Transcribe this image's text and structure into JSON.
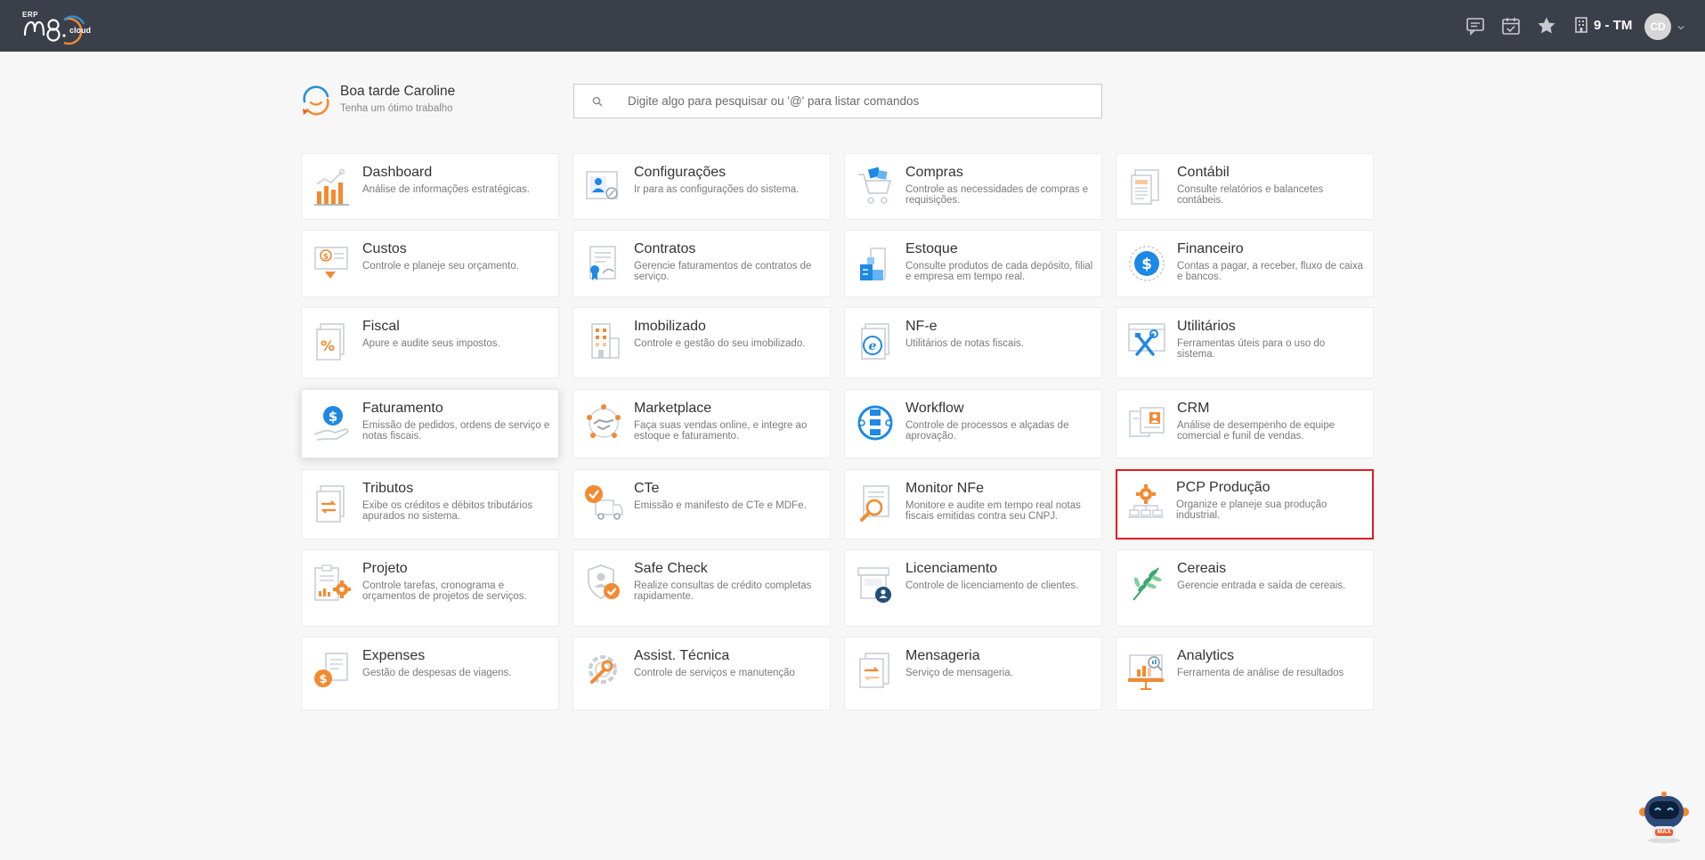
{
  "header": {
    "logo_erp": "ERP",
    "logo_cloud": "cloud",
    "company": "9 - TM",
    "avatar_initials": "CD",
    "icons": [
      "chat-icon",
      "calendar-check-icon",
      "star-icon",
      "building-icon",
      "chevron-down-icon"
    ]
  },
  "greeting": {
    "title": "Boa tarde Caroline",
    "subtitle": "Tenha um ótimo trabalho"
  },
  "search": {
    "placeholder": "Digite algo para pesquisar ou '@' para listar comandos",
    "value": ""
  },
  "modules": [
    {
      "title": "Dashboard",
      "desc": "Análise de informações estratégicas.",
      "icon": "bar-chart-icon"
    },
    {
      "title": "Configurações",
      "desc": "Ir para as configurações do sistema.",
      "icon": "settings-profile-icon"
    },
    {
      "title": "Compras",
      "desc": "Controle as necessidades de compras e requisições.",
      "icon": "shopping-cart-icon"
    },
    {
      "title": "Contábil",
      "desc": "Consulte relatórios e balancetes contábeis.",
      "icon": "ledger-icon"
    },
    {
      "title": "Custos",
      "desc": "Controle e planeje seu orçamento.",
      "icon": "cost-icon"
    },
    {
      "title": "Contratos",
      "desc": "Gerencie faturamentos de contratos de serviço.",
      "icon": "contract-icon"
    },
    {
      "title": "Estoque",
      "desc": "Consulte produtos de cada depósito, filial e empresa em tempo real.",
      "icon": "warehouse-icon"
    },
    {
      "title": "Financeiro",
      "desc": "Contas a pagar, a receber, fluxo de caixa e bancos.",
      "icon": "dollar-circle-icon"
    },
    {
      "title": "Fiscal",
      "desc": "Apure e audite seus impostos.",
      "icon": "percent-document-icon"
    },
    {
      "title": "Imobilizado",
      "desc": "Controle e gestão do seu imobilizado.",
      "icon": "building-icon"
    },
    {
      "title": "NF-e",
      "desc": "Utilitários de notas fiscais.",
      "icon": "nfe-document-icon"
    },
    {
      "title": "Utilitários",
      "desc": "Ferramentas úteis para o uso do sistema.",
      "icon": "tools-icon"
    },
    {
      "title": "Faturamento",
      "desc": "Emissão de pedidos, ordens de serviço e notas fiscais.",
      "icon": "hand-dollar-icon"
    },
    {
      "title": "Marketplace",
      "desc": "Faça suas vendas online, e integre ao estoque e faturamento.",
      "icon": "handshake-network-icon"
    },
    {
      "title": "Workflow",
      "desc": "Controle de processos e alçadas de aprovação.",
      "icon": "workflow-icon"
    },
    {
      "title": "CRM",
      "desc": "Análise de desempenho de equipe comercial e funil de vendas.",
      "icon": "crm-profile-icon"
    },
    {
      "title": "Tributos",
      "desc": "Exibe os créditos e débitos tributários apurados no sistema.",
      "icon": "exchange-document-icon"
    },
    {
      "title": "CTe",
      "desc": "Emissão e manifesto de CTe e MDFe.",
      "icon": "truck-check-icon"
    },
    {
      "title": "Monitor NFe",
      "desc": "Monitore e audite em tempo real notas fiscais emitidas contra seu CNPJ.",
      "icon": "magnifier-document-icon"
    },
    {
      "title": "PCP Produção",
      "desc": "Organize e planeje sua produção industrial.",
      "icon": "production-gear-icon"
    },
    {
      "title": "Projeto",
      "desc": "Controle tarefas, cronograma e orçamentos de projetos de serviços.",
      "icon": "project-gear-icon"
    },
    {
      "title": "Safe Check",
      "desc": "Realize consultas de crédito completas rapidamente.",
      "icon": "shield-check-icon"
    },
    {
      "title": "Licenciamento",
      "desc": "Controle de licenciamento de clientes.",
      "icon": "license-icon"
    },
    {
      "title": "Cereais",
      "desc": "Gerencie entrada e saída de cereais.",
      "icon": "wheat-icon"
    },
    {
      "title": "Expenses",
      "desc": "Gestão de despesas de viagens.",
      "icon": "expense-coin-icon"
    },
    {
      "title": "Assist. Técnica",
      "desc": "Controle de serviços e manutenção",
      "icon": "wrench-gear-icon"
    },
    {
      "title": "Mensageria",
      "desc": "Serviço de mensageria.",
      "icon": "message-exchange-icon"
    },
    {
      "title": "Analytics",
      "desc": "Ferramenta de análise de resultados",
      "icon": "analytics-board-icon"
    }
  ],
  "assistant": {
    "label": "MAX"
  },
  "colors": {
    "topbar": "#3b3f49",
    "accent_orange": "#f28a30",
    "accent_blue": "#1e88e5",
    "highlight_border": "#e11b22"
  }
}
